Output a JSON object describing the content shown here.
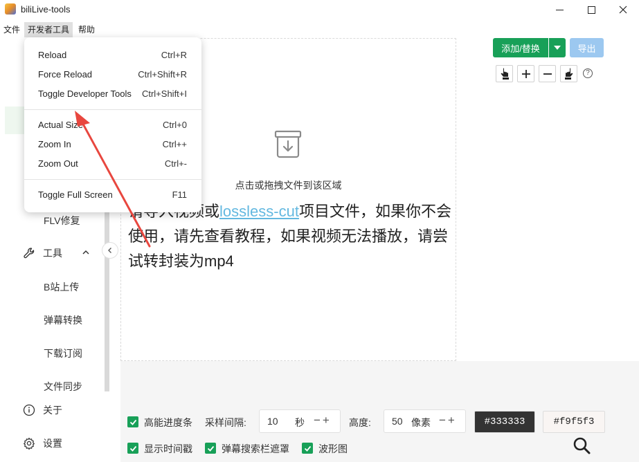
{
  "window": {
    "title": "biliLive-tools"
  },
  "menubar": {
    "items": [
      "文件",
      "开发者工具",
      "帮助"
    ]
  },
  "dev_menu": {
    "items": [
      {
        "label": "Reload",
        "shortcut": "Ctrl+R"
      },
      {
        "label": "Force Reload",
        "shortcut": "Ctrl+Shift+R"
      },
      {
        "label": "Toggle Developer Tools",
        "shortcut": "Ctrl+Shift+I"
      },
      {
        "label": "Actual Size",
        "shortcut": "Ctrl+0"
      },
      {
        "label": "Zoom In",
        "shortcut": "Ctrl++"
      },
      {
        "label": "Zoom Out",
        "shortcut": "Ctrl+-"
      },
      {
        "label": "Toggle Full Screen",
        "shortcut": "F11"
      }
    ]
  },
  "sidebar": {
    "flv_repair": "FLV修复",
    "tools": "工具",
    "tool_items": [
      "B站上传",
      "弹幕转换",
      "下载订阅",
      "文件同步"
    ],
    "about": "关于",
    "settings": "设置"
  },
  "toolbar": {
    "add_replace": "添加/替换",
    "export": "导出",
    "help": "?"
  },
  "dropzone": {
    "title": "点击或拖拽文件到该区域",
    "hint_before": "请导入视频或",
    "hint_link": "lossless-cut",
    "hint_after": "项目文件，如果你不会使用，请先查看教程，如果视频无法播放，请尝试转封装为mp4"
  },
  "bottom": {
    "high_progress": "高能进度条",
    "sample_interval_label": "采样间隔:",
    "sample_interval_value": "10",
    "sample_interval_unit": "秒",
    "height_label": "高度:",
    "height_value": "50",
    "height_unit": "像素",
    "color1": "#333333",
    "color2": "#f9f5f3",
    "show_timestamp": "显示时间戳",
    "danmaku_mask": "弹幕搜索栏遮罩",
    "waveform": "波形图"
  },
  "colors": {
    "accent": "#18a058",
    "export_btn": "#9cc8f0",
    "link": "#63b8e0",
    "annotation": "#e8473f"
  }
}
